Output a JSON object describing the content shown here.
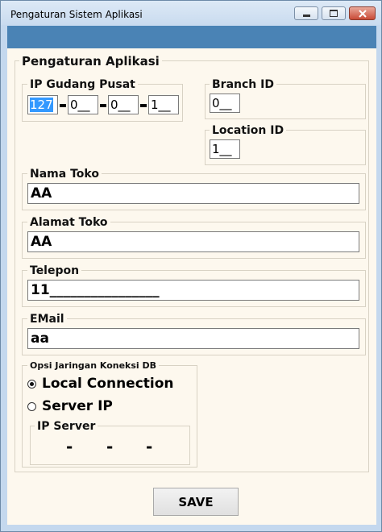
{
  "window": {
    "title": "Pengaturan Sistem Aplikasi",
    "minimize_icon": "minimize-icon",
    "maximize_icon": "maximize-icon",
    "close_icon": "close-icon"
  },
  "app_settings": {
    "legend": "Pengaturan Aplikasi",
    "ip_gudang_pusat": {
      "label": "IP Gudang Pusat",
      "octets": [
        "127",
        "0__",
        "0__",
        "1__"
      ],
      "separator": "-"
    },
    "branch_id": {
      "label": "Branch ID",
      "value": "0__"
    },
    "location_id": {
      "label": "Location ID",
      "value": "1__"
    },
    "nama_toko": {
      "label": "Nama Toko",
      "value": "AA"
    },
    "alamat_toko": {
      "label": "Alamat Toko",
      "value": "AA"
    },
    "telepon": {
      "label": "Telepon",
      "value": "11________________"
    },
    "email": {
      "label": "EMail",
      "value": "aa"
    }
  },
  "db_options": {
    "legend": "Opsi Jaringan Koneksi DB",
    "options": [
      {
        "label": "Local Connection",
        "checked": true
      },
      {
        "label": "Server IP",
        "checked": false
      }
    ],
    "ip_server": {
      "label": "IP Server",
      "dashes": [
        "-",
        "-",
        "-"
      ]
    }
  },
  "footer": {
    "save_label": "SAVE"
  },
  "colors": {
    "band": "#4a83b5",
    "client_bg": "#fdf8ee",
    "selection": "#3399ff"
  }
}
